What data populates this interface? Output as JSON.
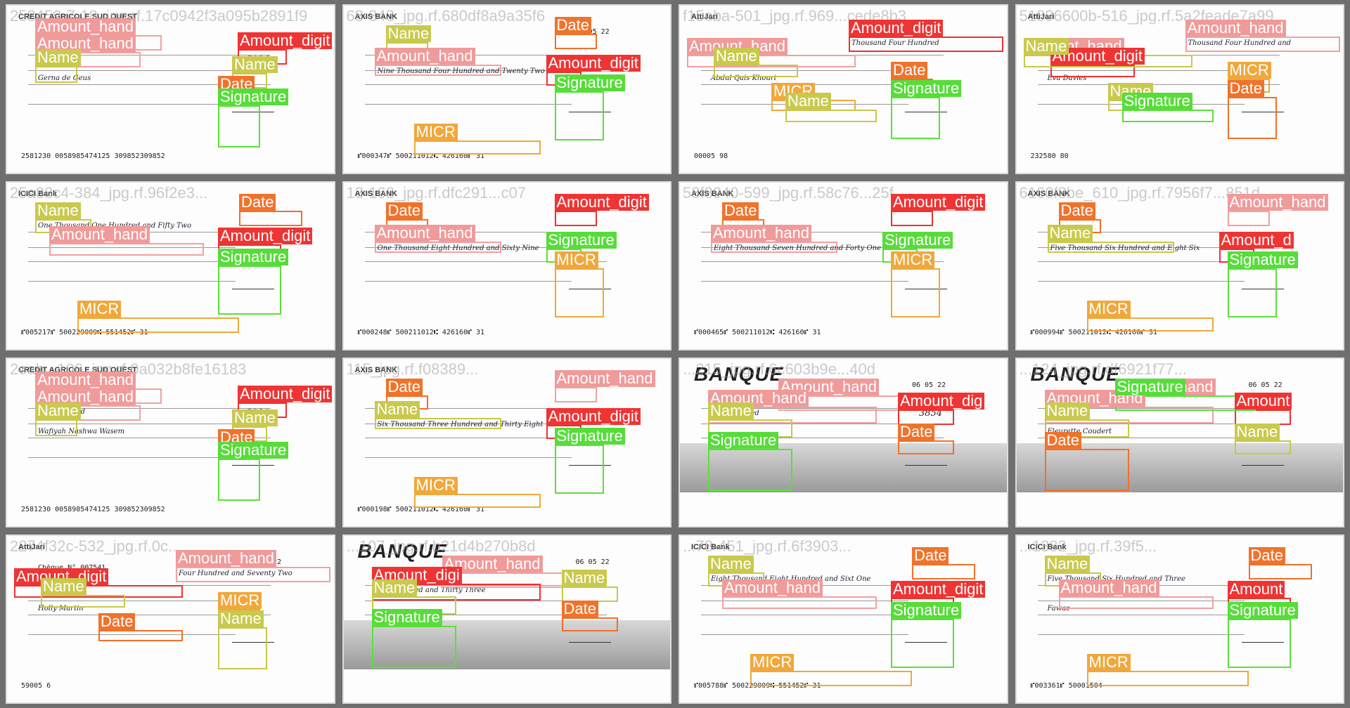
{
  "colors": {
    "amount_hand": "#f09a9a",
    "amount_digit": "#ef3434",
    "name": "#c9c94e",
    "date": "#f0732c",
    "signature": "#57dc3a",
    "micr": "#f0a83c"
  },
  "tiles": [
    {
      "filename": "258459-7-18_jpg.rf.17c0942f3a095b2891f9",
      "bank": "CREDIT AGRICOLE SUD OUEST",
      "layout": "ca",
      "texts": {
        "name": "Gerna de Geus",
        "hand": "Hundred",
        "digit": "5934",
        "micr": "2581230        0058985474125        309852309852"
      },
      "boxes": [
        {
          "cls": "hand",
          "label": "Amount_hand"
        },
        {
          "cls": "hand",
          "label": "Amount_hand"
        },
        {
          "cls": "digit",
          "label": "Amount_digit"
        },
        {
          "cls": "name",
          "label": "Name"
        },
        {
          "cls": "name",
          "label": "Name"
        },
        {
          "cls": "date",
          "label": "Date"
        },
        {
          "cls": "sig",
          "label": "Signature"
        }
      ]
    },
    {
      "filename": "68-343_jpg.rf.680df8a9a35f6",
      "bank": "AXIS BANK",
      "layout": "axis",
      "texts": {
        "name": "",
        "hand": "Nine Thousand Four Hundred and Twenty Two",
        "digit": "",
        "micr": "⑈000347⑈ 500211012⑆ 426160⑈ 31",
        "date": "06 05 22"
      },
      "boxes": [
        {
          "cls": "name",
          "label": "Name"
        },
        {
          "cls": "hand",
          "label": "Amount_hand"
        },
        {
          "cls": "date",
          "label": "Date"
        },
        {
          "cls": "digit",
          "label": "Amount_digit"
        },
        {
          "cls": "sig",
          "label": "Signature"
        },
        {
          "cls": "micr",
          "label": "MICR"
        }
      ]
    },
    {
      "filename": "f15eba-501_jpg.rf.969...cede8b3",
      "bank": "AttiJari",
      "layout": "atti",
      "texts": {
        "name": "Abdul Qais Khouri",
        "hand": "Thousand Four Hundred",
        "digit": "",
        "micr": "00005 98"
      },
      "boxes": [
        {
          "cls": "hand",
          "label": "Amount_hand"
        },
        {
          "cls": "digit",
          "label": "Amount_digit"
        },
        {
          "cls": "name",
          "label": "Name"
        },
        {
          "cls": "micr",
          "label": "MICR"
        },
        {
          "cls": "date",
          "label": "Date"
        },
        {
          "cls": "sig",
          "label": "Signature"
        },
        {
          "cls": "name",
          "label": "Name"
        }
      ]
    },
    {
      "filename": "51896600b-516_jpg.rf.5a2feade7a99",
      "bank": "AttiJari",
      "layout": "atti",
      "texts": {
        "name": "Eva Davies",
        "hand": "Thousand Four Hundred and",
        "digit": "",
        "micr": "232580 80"
      },
      "boxes": [
        {
          "cls": "hand",
          "label": "Amount_hand"
        },
        {
          "cls": "hand",
          "label": "Amount_hand"
        },
        {
          "cls": "digit",
          "label": "Amount_digit"
        },
        {
          "cls": "name",
          "label": "Name"
        },
        {
          "cls": "micr",
          "label": "MICR"
        },
        {
          "cls": "date",
          "label": "Date"
        },
        {
          "cls": "sig",
          "label": "Signature"
        },
        {
          "cls": "name",
          "label": "Name"
        }
      ]
    },
    {
      "filename": "25a88c4-384_jpg.rf.96f2e3...",
      "bank": "ICICI Bank",
      "layout": "icici",
      "texts": {
        "name": "",
        "hand": "One Thousand One Hundred and Fifty Two",
        "digit": "152",
        "micr": "⑈005217⑈ 500229009⑆ 551452⑈ 31",
        "date": "06 05 22"
      },
      "boxes": [
        {
          "cls": "date",
          "label": "Date"
        },
        {
          "cls": "name",
          "label": "Name"
        },
        {
          "cls": "hand",
          "label": "Amount_hand"
        },
        {
          "cls": "digit",
          "label": "Amount_digit"
        },
        {
          "cls": "sig",
          "label": "Signature"
        },
        {
          "cls": "micr",
          "label": "MICR"
        }
      ]
    },
    {
      "filename": "13-168_jpg.rf.dfc291...c07",
      "bank": "AXIS BANK",
      "layout": "axis",
      "texts": {
        "name": "",
        "hand": "One Thousand Eight Hundred and Sixty Nine",
        "digit": "",
        "micr": "⑈000248⑈ 500211012⑆ 426160⑈ 31",
        "date": "06 05 22"
      },
      "boxes": [
        {
          "cls": "date",
          "label": "Date"
        },
        {
          "cls": "hand",
          "label": "Amount_hand"
        },
        {
          "cls": "digit",
          "label": "Amount_digit"
        },
        {
          "cls": "sig",
          "label": "Signature"
        },
        {
          "cls": "micr",
          "label": "MICR"
        }
      ]
    },
    {
      "filename": "58f8940-599_jpg.rf.58c76...25f",
      "bank": "AXIS BANK",
      "layout": "axis",
      "texts": {
        "name": "",
        "hand": "Eight Thousand Seven Hundred and Forty One",
        "digit": "",
        "micr": "⑈000465⑈ 500211012⑆ 426160⑈ 31",
        "date": "06 05 22"
      },
      "boxes": [
        {
          "cls": "date",
          "label": "Date"
        },
        {
          "cls": "hand",
          "label": "Amount_hand"
        },
        {
          "cls": "digit",
          "label": "Amount_digit"
        },
        {
          "cls": "sig",
          "label": "Signature"
        },
        {
          "cls": "micr",
          "label": "MICR"
        }
      ]
    },
    {
      "filename": "6160f8be_610_jpg.rf.7956f7...851d",
      "bank": "AXIS BANK",
      "layout": "axis",
      "texts": {
        "name": "",
        "hand": "Five Thousand Six Hundred and Eight Six",
        "digit": "",
        "micr": "⑈000994⑈ 500211012⑆ 426160⑈ 31",
        "date": "06 05 22"
      },
      "boxes": [
        {
          "cls": "date",
          "label": "Date"
        },
        {
          "cls": "name",
          "label": "Name"
        },
        {
          "cls": "hand",
          "label": "Amount_hand"
        },
        {
          "cls": "digit",
          "label": "Amount_d"
        },
        {
          "cls": "sig",
          "label": "Signature"
        },
        {
          "cls": "micr",
          "label": "MICR"
        }
      ]
    },
    {
      "filename": "2eab...106_jpg.rf.0a032b8fe16183",
      "bank": "CREDIT AGRICOLE SUD OUEST",
      "layout": "ca",
      "texts": {
        "name": "Wafiyah Nashwa Wasem",
        "hand": "Hundred and",
        "digit": "5210",
        "micr": "2581230        0058985474125        309852309852"
      },
      "boxes": [
        {
          "cls": "hand",
          "label": "Amount_hand"
        },
        {
          "cls": "hand",
          "label": "Amount_hand"
        },
        {
          "cls": "digit",
          "label": "Amount_digit"
        },
        {
          "cls": "name",
          "label": "Name"
        },
        {
          "cls": "name",
          "label": "Name"
        },
        {
          "cls": "date",
          "label": "Date"
        },
        {
          "cls": "sig",
          "label": "Signature"
        }
      ]
    },
    {
      "filename": "115_jpg.rf.f08389...",
      "bank": "AXIS BANK",
      "layout": "axis",
      "texts": {
        "name": "",
        "hand": "Six Thousand Three Hundred and Thirty Eight",
        "digit": "",
        "micr": "⑈000198⑈ 500211012⑆ 426160⑈ 31",
        "date": "06 05 22"
      },
      "boxes": [
        {
          "cls": "date",
          "label": "Date"
        },
        {
          "cls": "name",
          "label": "Name"
        },
        {
          "cls": "hand",
          "label": "Amount_hand"
        },
        {
          "cls": "digit",
          "label": "Amount_digit"
        },
        {
          "cls": "sig",
          "label": "Signature"
        },
        {
          "cls": "micr",
          "label": "MICR"
        }
      ]
    },
    {
      "filename": "...215_jpg.rf.6c603b9e...40d",
      "bank": "BANQUE",
      "layout": "banque",
      "texts": {
        "name": "",
        "hand": "Eiat Hundred",
        "digit": "3854",
        "micr": "",
        "date": "06 05 22"
      },
      "boxes": [
        {
          "cls": "hand",
          "label": "Amount_hand"
        },
        {
          "cls": "hand",
          "label": "Amount_hand"
        },
        {
          "cls": "digit",
          "label": "Amount_dig"
        },
        {
          "cls": "name",
          "label": "Name"
        },
        {
          "cls": "date",
          "label": "Date"
        },
        {
          "cls": "sig",
          "label": "Signature"
        }
      ]
    },
    {
      "filename": "...124_jpg.rf.df6921f77...",
      "bank": "BANQUE",
      "layout": "banque",
      "texts": {
        "name": "Fleurette Coudert",
        "hand": "Hundred",
        "digit": "",
        "micr": "",
        "date": "06 05 22"
      },
      "boxes": [
        {
          "cls": "hand",
          "label": "Amount_hand"
        },
        {
          "cls": "hand",
          "label": "Amount_hand"
        },
        {
          "cls": "digit",
          "label": "Amount"
        },
        {
          "cls": "name",
          "label": "Name"
        },
        {
          "cls": "name",
          "label": "Name"
        },
        {
          "cls": "date",
          "label": "Date"
        },
        {
          "cls": "sig",
          "label": "Signature"
        }
      ]
    },
    {
      "filename": "2274f32c-532_jpg.rf.0c...",
      "bank": "AttiJari",
      "layout": "atti",
      "texts": {
        "name": "Holly Martin",
        "hand": "Four Hundred and Seventy Two",
        "digit": "",
        "micr": "59005 6",
        "date": "01/01/2022",
        "cheque": "Chèque N° 007541"
      },
      "boxes": [
        {
          "cls": "digit",
          "label": "Amount_digit"
        },
        {
          "cls": "hand",
          "label": "Amount_hand"
        },
        {
          "cls": "name",
          "label": "Name"
        },
        {
          "cls": "date",
          "label": "Date"
        },
        {
          "cls": "micr",
          "label": "MICR"
        },
        {
          "cls": "name",
          "label": "Name"
        }
      ]
    },
    {
      "filename": "...107_jpg.rf.b21d4b270b8d",
      "bank": "BANQUE",
      "layout": "banque",
      "texts": {
        "name": "",
        "hand": "Two Hundred and Thirty Three",
        "digit": "",
        "micr": "",
        "date": "06 05 22"
      },
      "boxes": [
        {
          "cls": "hand",
          "label": "Amount_hand"
        },
        {
          "cls": "digit",
          "label": "Amount_digi"
        },
        {
          "cls": "name",
          "label": "Name"
        },
        {
          "cls": "name",
          "label": "Name"
        },
        {
          "cls": "date",
          "label": "Date"
        },
        {
          "cls": "sig",
          "label": "Signature"
        }
      ]
    },
    {
      "filename": "...78-451_jpg.rf.6f3903...",
      "bank": "ICICI Bank",
      "layout": "icici",
      "texts": {
        "name": "",
        "hand": "Eight Thousand Eight Hundred and Sixt One",
        "digit": "",
        "micr": "⑈005788⑈ 500229009⑆ 551452⑈ 31",
        "date": "06 05 22"
      },
      "boxes": [
        {
          "cls": "date",
          "label": "Date"
        },
        {
          "cls": "name",
          "label": "Name"
        },
        {
          "cls": "hand",
          "label": "Amount_hand"
        },
        {
          "cls": "digit",
          "label": "Amount_digit"
        },
        {
          "cls": "sig",
          "label": "Signature"
        },
        {
          "cls": "micr",
          "label": "MICR"
        }
      ]
    },
    {
      "filename": "...1382_jpg.rf.39f5...",
      "bank": "ICICI Bank",
      "layout": "icici",
      "texts": {
        "name": "Fawaz",
        "hand": "Five Thousand Six Hundred and Three",
        "digit": "5603",
        "micr": "⑈003361⑈ 50001504",
        "date": "06 05 22"
      },
      "boxes": [
        {
          "cls": "date",
          "label": "Date"
        },
        {
          "cls": "name",
          "label": "Name"
        },
        {
          "cls": "hand",
          "label": "Amount_hand"
        },
        {
          "cls": "digit",
          "label": "Amount"
        },
        {
          "cls": "sig",
          "label": "Signature"
        },
        {
          "cls": "micr",
          "label": "MICR"
        }
      ]
    }
  ]
}
